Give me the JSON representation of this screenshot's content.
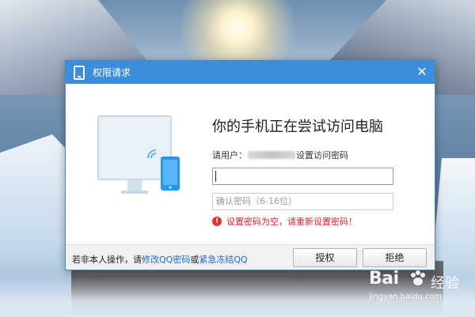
{
  "dialog": {
    "title": "权限请求",
    "close_glyph": "✕",
    "heading": "你的手机正在尝试访问电脑",
    "user_prefix": "请用户：",
    "user_suffix": "设置访问密码",
    "password_value": "",
    "confirm_placeholder": "确认密码（6-16位）",
    "error_text": "设置密码为空，请重新设置密码！",
    "error_glyph": "!"
  },
  "footer": {
    "prefix": "若非本人操作，请",
    "link_modify": "修改QQ密码",
    "or": "或",
    "link_freeze": "紧急冻结QQ"
  },
  "buttons": {
    "authorize": "授权",
    "reject": "拒绝"
  },
  "watermark": {
    "brand": "Bai",
    "brand2": "经验",
    "url": "jingyan.baidu.com"
  },
  "colors": {
    "titlebar": "#3c8ddc",
    "link": "#1b6ac9",
    "error": "#d7262b",
    "phone": "#2196f3"
  },
  "icons": {
    "title": "phone-icon",
    "close": "close-icon",
    "error": "error-icon",
    "illustration": "computer-phone-illustration"
  }
}
